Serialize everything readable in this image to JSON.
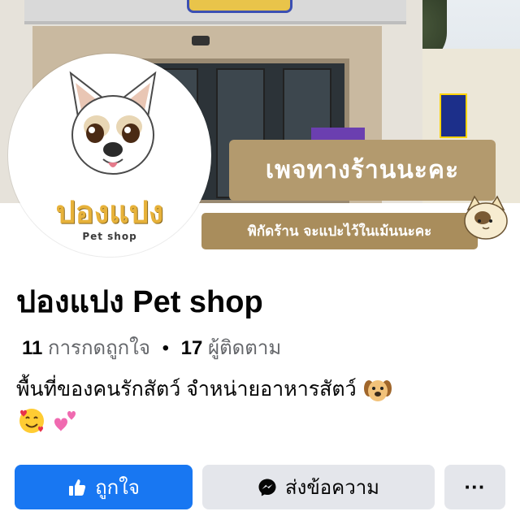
{
  "cover": {
    "caption_main": "เพจทางร้านนะคะ",
    "caption_sub": "พิกัดร้าน จะแปะไว้ในเม้นนะคะ"
  },
  "avatar": {
    "name": "ปองแปง",
    "subtitle": "Pet shop"
  },
  "page": {
    "title": "ปองแปง Pet shop",
    "likes_count": "11",
    "likes_label": "การกดถูกใจ",
    "separator": "•",
    "followers_count": "17",
    "followers_label": "ผู้ติดตาม",
    "bio": "พื้นที่ของคนรักสัตว์ จำหน่ายอาหารสัตว์"
  },
  "actions": {
    "like_label": "ถูกใจ",
    "message_label": "ส่งข้อความ",
    "more_label": "···"
  },
  "icons": {
    "like": "thumbs-up-icon",
    "messenger": "messenger-icon",
    "more": "more-dots-icon"
  },
  "colors": {
    "primary": "#1877f2",
    "secondary_button": "#e4e6eb",
    "muted_text": "#65676b",
    "caption_bg": "#b39a6e"
  }
}
